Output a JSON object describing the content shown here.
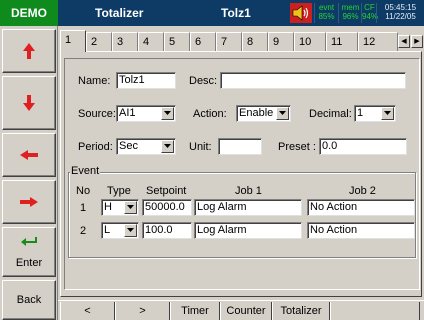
{
  "header": {
    "demo_label": "DEMO",
    "screen_title": "Totalizer",
    "totalizer_name": "Tolz1",
    "status": [
      {
        "label": "evnt",
        "value": "85%"
      },
      {
        "label": "mem",
        "value": "96%"
      },
      {
        "label": "CF",
        "value": "94%"
      }
    ],
    "time": "05:45:15",
    "date": "11/22/05"
  },
  "sidebar": {
    "buttons": [
      {
        "name": "up-arrow-button",
        "icon": "arrow-up-icon"
      },
      {
        "name": "down-arrow-button",
        "icon": "arrow-down-icon"
      },
      {
        "name": "left-arrow-button",
        "icon": "arrow-left-icon"
      },
      {
        "name": "right-arrow-button",
        "icon": "arrow-right-icon"
      }
    ],
    "enter_label": "Enter",
    "back_label": "Back",
    "arrow_color": "#e02020",
    "enter_color": "#1a8a1a"
  },
  "tabs": [
    "1",
    "2",
    "3",
    "4",
    "5",
    "6",
    "7",
    "8",
    "9",
    "10",
    "11",
    "12"
  ],
  "active_tab": "1",
  "form": {
    "name_label": "Name:",
    "name_value": "Tolz1",
    "desc_label": "Desc:",
    "desc_value": "",
    "source_label": "Source:",
    "source_value": "AI1",
    "action_label": "Action:",
    "action_value": "Enable",
    "decimal_label": "Decimal:",
    "decimal_value": "1",
    "period_label": "Period:",
    "period_value": "Sec",
    "unit_label": "Unit:",
    "unit_value": "",
    "preset_label": "Preset :",
    "preset_value": "0.0"
  },
  "event": {
    "group_title": "Event",
    "col_no": "No",
    "col_type": "Type",
    "col_setpoint": "Setpoint",
    "col_job1": "Job 1",
    "col_job2": "Job 2",
    "rows": [
      {
        "no": "1",
        "type": "H",
        "setpoint": "50000.0",
        "job1": "Log Alarm",
        "job2": "No Action"
      },
      {
        "no": "2",
        "type": "L",
        "setpoint": "100.0",
        "job1": "Log Alarm",
        "job2": "No Action"
      }
    ]
  },
  "bottom_bar": {
    "prev": "<",
    "next": ">",
    "buttons": [
      "Timer",
      "Counter",
      "Totalizer"
    ]
  }
}
